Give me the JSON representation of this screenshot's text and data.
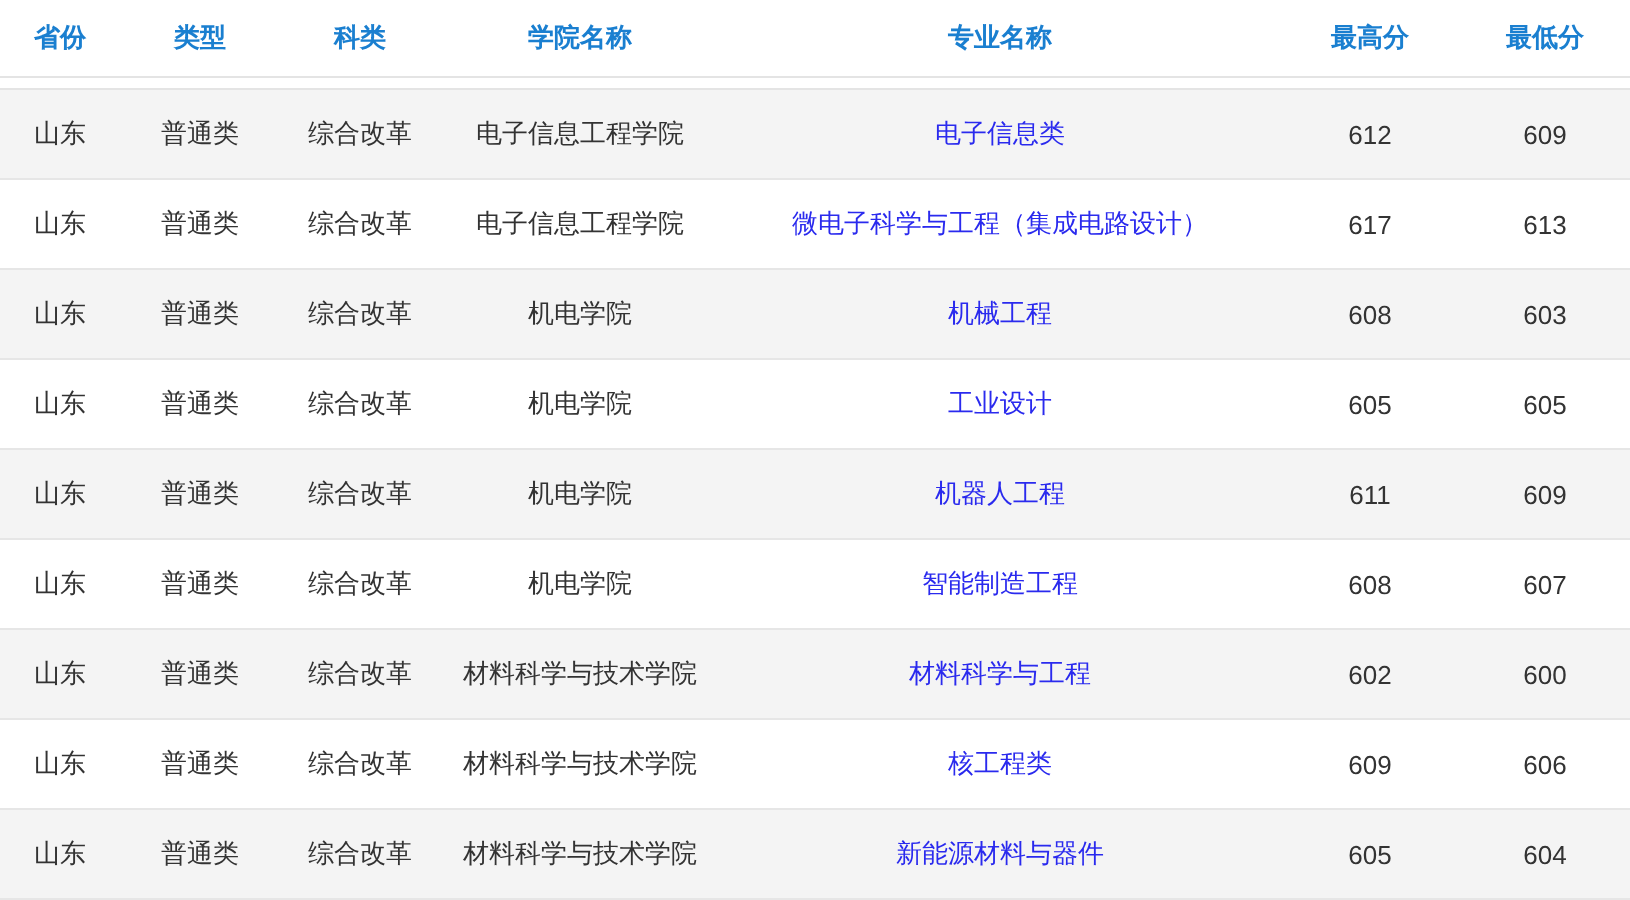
{
  "table": {
    "columns": [
      "省份",
      "类型",
      "科类",
      "学院名称",
      "专业名称",
      "最高分",
      "最低分"
    ],
    "rows": [
      {
        "province": "山东",
        "type": "普通类",
        "category": "综合改革",
        "college": "电子信息工程学院",
        "major": "电子信息类",
        "max": "612",
        "min": "609"
      },
      {
        "province": "山东",
        "type": "普通类",
        "category": "综合改革",
        "college": "电子信息工程学院",
        "major": "微电子科学与工程（集成电路设计）",
        "max": "617",
        "min": "613"
      },
      {
        "province": "山东",
        "type": "普通类",
        "category": "综合改革",
        "college": "机电学院",
        "major": "机械工程",
        "max": "608",
        "min": "603"
      },
      {
        "province": "山东",
        "type": "普通类",
        "category": "综合改革",
        "college": "机电学院",
        "major": "工业设计",
        "max": "605",
        "min": "605"
      },
      {
        "province": "山东",
        "type": "普通类",
        "category": "综合改革",
        "college": "机电学院",
        "major": "机器人工程",
        "max": "611",
        "min": "609"
      },
      {
        "province": "山东",
        "type": "普通类",
        "category": "综合改革",
        "college": "机电学院",
        "major": "智能制造工程",
        "max": "608",
        "min": "607"
      },
      {
        "province": "山东",
        "type": "普通类",
        "category": "综合改革",
        "college": "材料科学与技术学院",
        "major": "材料科学与工程",
        "max": "602",
        "min": "600"
      },
      {
        "province": "山东",
        "type": "普通类",
        "category": "综合改革",
        "college": "材料科学与技术学院",
        "major": "核工程类",
        "max": "609",
        "min": "606"
      },
      {
        "province": "山东",
        "type": "普通类",
        "category": "综合改革",
        "college": "材料科学与技术学院",
        "major": "新能源材料与器件",
        "max": "605",
        "min": "604"
      }
    ]
  }
}
